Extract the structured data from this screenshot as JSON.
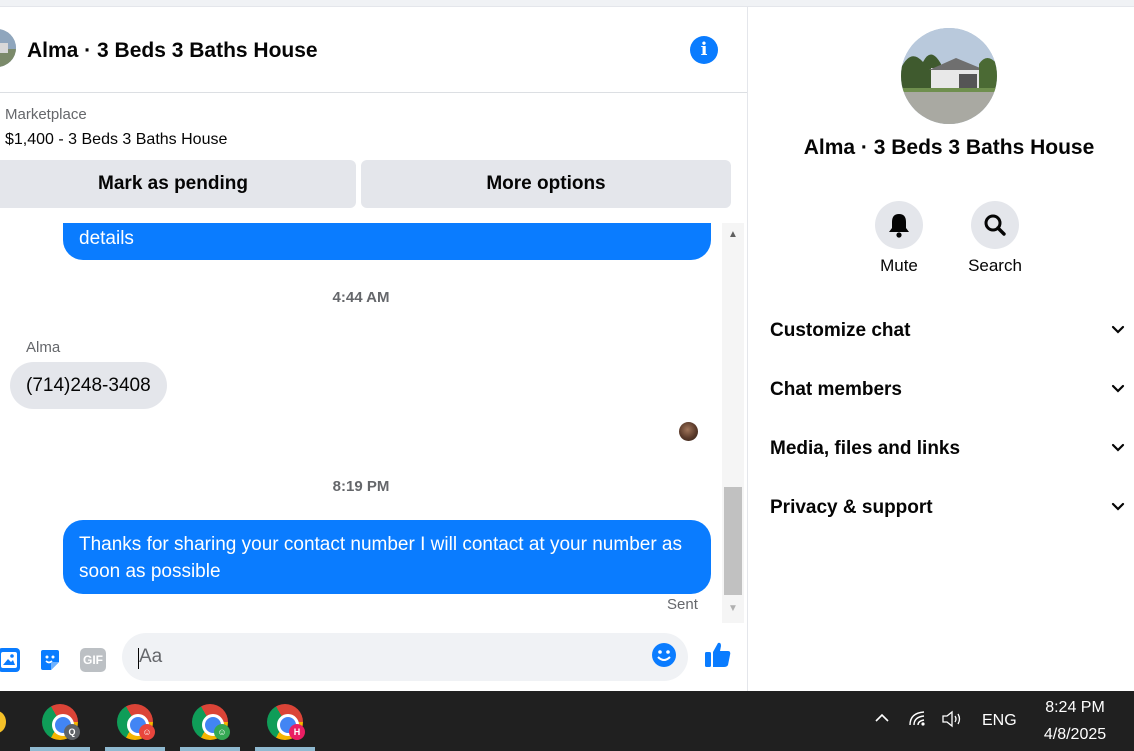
{
  "chat": {
    "title": "Alma · 3 Beds 3 Baths House",
    "listing": {
      "label": "Marketplace",
      "title": "$1,400 - 3 Beds 3 Baths House",
      "pending_button": "Mark as pending",
      "more_button": "More options"
    },
    "messages": [
      {
        "direction": "out",
        "text": "details"
      },
      {
        "type": "timestamp",
        "text": "4:44 AM"
      },
      {
        "direction": "in",
        "sender": "Alma",
        "text": "(714)248-3408"
      },
      {
        "type": "timestamp",
        "text": "8:19 PM"
      },
      {
        "direction": "out",
        "text": "Thanks for sharing your contact number I will contact at your number as soon as possible",
        "status": "Sent"
      }
    ],
    "composer": {
      "placeholder": "Aa",
      "gif_label": "GIF"
    }
  },
  "details": {
    "title": "Alma · 3 Beds 3 Baths House",
    "actions": [
      {
        "label": "Mute",
        "icon": "bell-icon"
      },
      {
        "label": "Search",
        "icon": "search-icon"
      }
    ],
    "sections": [
      {
        "label": "Customize chat"
      },
      {
        "label": "Chat members"
      },
      {
        "label": "Media, files and links"
      },
      {
        "label": "Privacy & support"
      }
    ]
  },
  "taskbar": {
    "apps": [
      {
        "icon": "chrome-icon",
        "badge": "Q",
        "badge_color": "#5f6368"
      },
      {
        "icon": "chrome-icon",
        "badge": "☺",
        "badge_color": "#e8453c"
      },
      {
        "icon": "chrome-icon",
        "badge": "☺",
        "badge_color": "#34a853"
      },
      {
        "icon": "chrome-icon",
        "badge": "H",
        "badge_color": "#e91e63"
      }
    ],
    "language": "ENG",
    "time": "8:24 PM",
    "date": "4/8/2025"
  },
  "colors": {
    "accent": "#0a7cff",
    "bubble_in": "#e4e6eb",
    "taskbar": "#202020"
  }
}
